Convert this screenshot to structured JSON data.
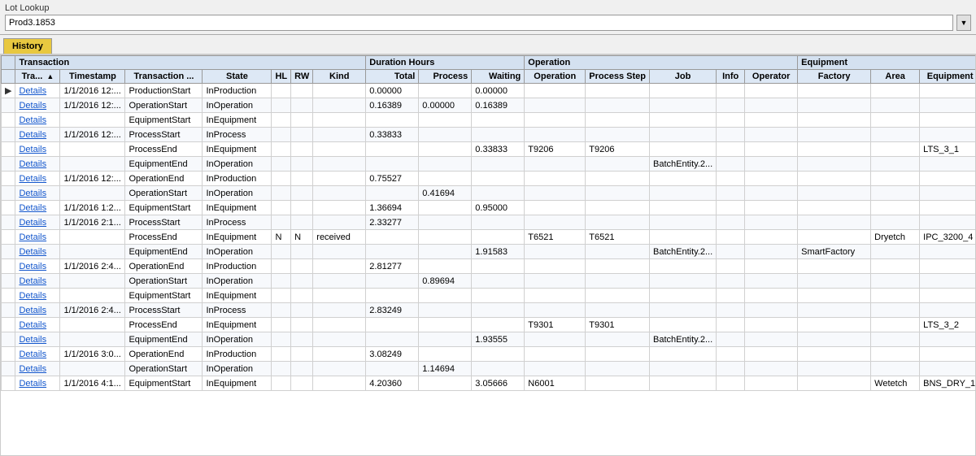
{
  "app": {
    "title": "Lot Lookup",
    "lot_value": "Prod3.1853"
  },
  "tab": {
    "label": "History"
  },
  "table": {
    "header_groups": [
      {
        "label": "Transaction",
        "colspan": 7
      },
      {
        "label": "Duration Hours",
        "colspan": 3
      },
      {
        "label": "Operation",
        "colspan": 5
      },
      {
        "label": "Equipment",
        "colspan": 3
      }
    ],
    "columns": [
      {
        "id": "arrow",
        "label": ""
      },
      {
        "id": "tra",
        "label": "Tra...",
        "sortable": true
      },
      {
        "id": "timestamp",
        "label": "Timestamp"
      },
      {
        "id": "transaction",
        "label": "Transaction ..."
      },
      {
        "id": "state",
        "label": "State"
      },
      {
        "id": "hl",
        "label": "HL"
      },
      {
        "id": "rw",
        "label": "RW"
      },
      {
        "id": "kind",
        "label": "Kind"
      },
      {
        "id": "total",
        "label": "Total"
      },
      {
        "id": "process",
        "label": "Process"
      },
      {
        "id": "waiting",
        "label": "Waiting"
      },
      {
        "id": "operation",
        "label": "Operation"
      },
      {
        "id": "processstep",
        "label": "Process Step"
      },
      {
        "id": "job",
        "label": "Job"
      },
      {
        "id": "info",
        "label": "Info"
      },
      {
        "id": "operator",
        "label": "Operator"
      },
      {
        "id": "factory",
        "label": "Factory"
      },
      {
        "id": "area",
        "label": "Area"
      },
      {
        "id": "equipment",
        "label": "Equipment"
      }
    ],
    "rows": [
      {
        "arrow": "▶",
        "tra": "Details",
        "timestamp": "1/1/2016 12:...",
        "transaction": "ProductionStart",
        "state": "InProduction",
        "hl": "",
        "rw": "",
        "kind": "",
        "total": "0.00000",
        "process": "",
        "waiting": "0.00000",
        "operation": "",
        "processstep": "",
        "job": "",
        "info": "",
        "operator": "",
        "factory": "",
        "area": "",
        "equipment": ""
      },
      {
        "arrow": "",
        "tra": "Details",
        "timestamp": "1/1/2016 12:...",
        "transaction": "OperationStart",
        "state": "InOperation",
        "hl": "",
        "rw": "",
        "kind": "",
        "total": "0.16389",
        "process": "0.00000",
        "waiting": "0.16389",
        "operation": "",
        "processstep": "",
        "job": "",
        "info": "",
        "operator": "",
        "factory": "",
        "area": "",
        "equipment": ""
      },
      {
        "arrow": "",
        "tra": "Details",
        "timestamp": "",
        "transaction": "EquipmentStart",
        "state": "InEquipment",
        "hl": "",
        "rw": "",
        "kind": "",
        "total": "",
        "process": "",
        "waiting": "",
        "operation": "",
        "processstep": "",
        "job": "",
        "info": "",
        "operator": "",
        "factory": "",
        "area": "",
        "equipment": ""
      },
      {
        "arrow": "",
        "tra": "Details",
        "timestamp": "1/1/2016 12:...",
        "transaction": "ProcessStart",
        "state": "InProcess",
        "hl": "",
        "rw": "",
        "kind": "",
        "total": "0.33833",
        "process": "",
        "waiting": "",
        "operation": "",
        "processstep": "",
        "job": "",
        "info": "",
        "operator": "",
        "factory": "",
        "area": "",
        "equipment": ""
      },
      {
        "arrow": "",
        "tra": "Details",
        "timestamp": "",
        "transaction": "ProcessEnd",
        "state": "InEquipment",
        "hl": "",
        "rw": "",
        "kind": "",
        "total": "",
        "process": "",
        "waiting": "0.33833",
        "operation": "T9206",
        "processstep": "T9206",
        "job": "",
        "info": "",
        "operator": "",
        "factory": "",
        "area": "",
        "equipment": "LTS_3_1"
      },
      {
        "arrow": "",
        "tra": "Details",
        "timestamp": "",
        "transaction": "EquipmentEnd",
        "state": "InOperation",
        "hl": "",
        "rw": "",
        "kind": "",
        "total": "",
        "process": "",
        "waiting": "",
        "operation": "",
        "processstep": "",
        "job": "BatchEntity.2...",
        "info": "",
        "operator": "",
        "factory": "",
        "area": "",
        "equipment": ""
      },
      {
        "arrow": "",
        "tra": "Details",
        "timestamp": "1/1/2016 12:...",
        "transaction": "OperationEnd",
        "state": "InProduction",
        "hl": "",
        "rw": "",
        "kind": "",
        "total": "0.75527",
        "process": "",
        "waiting": "",
        "operation": "",
        "processstep": "",
        "job": "",
        "info": "",
        "operator": "",
        "factory": "",
        "area": "",
        "equipment": ""
      },
      {
        "arrow": "",
        "tra": "Details",
        "timestamp": "",
        "transaction": "OperationStart",
        "state": "InOperation",
        "hl": "",
        "rw": "",
        "kind": "",
        "total": "",
        "process": "0.41694",
        "waiting": "",
        "operation": "",
        "processstep": "",
        "job": "",
        "info": "",
        "operator": "",
        "factory": "",
        "area": "",
        "equipment": ""
      },
      {
        "arrow": "",
        "tra": "Details",
        "timestamp": "1/1/2016 1:2...",
        "transaction": "EquipmentStart",
        "state": "InEquipment",
        "hl": "",
        "rw": "",
        "kind": "",
        "total": "1.36694",
        "process": "",
        "waiting": "0.95000",
        "operation": "",
        "processstep": "",
        "job": "",
        "info": "",
        "operator": "",
        "factory": "",
        "area": "",
        "equipment": ""
      },
      {
        "arrow": "",
        "tra": "Details",
        "timestamp": "1/1/2016 2:1...",
        "transaction": "ProcessStart",
        "state": "InProcess",
        "hl": "",
        "rw": "",
        "kind": "",
        "total": "2.33277",
        "process": "",
        "waiting": "",
        "operation": "",
        "processstep": "",
        "job": "",
        "info": "",
        "operator": "",
        "factory": "",
        "area": "",
        "equipment": ""
      },
      {
        "arrow": "",
        "tra": "Details",
        "timestamp": "",
        "transaction": "ProcessEnd",
        "state": "InEquipment",
        "hl": "N",
        "rw": "N",
        "kind": "received",
        "total": "",
        "process": "",
        "waiting": "",
        "operation": "T6521",
        "processstep": "T6521",
        "job": "",
        "info": "",
        "operator": "",
        "factory": "",
        "area": "Dryetch",
        "equipment": "IPC_3200_4"
      },
      {
        "arrow": "",
        "tra": "Details",
        "timestamp": "",
        "transaction": "EquipmentEnd",
        "state": "InOperation",
        "hl": "",
        "rw": "",
        "kind": "",
        "total": "",
        "process": "",
        "waiting": "1.91583",
        "operation": "",
        "processstep": "",
        "job": "BatchEntity.2...",
        "info": "",
        "operator": "",
        "factory": "SmartFactory",
        "area": "",
        "equipment": ""
      },
      {
        "arrow": "",
        "tra": "Details",
        "timestamp": "1/1/2016 2:4...",
        "transaction": "OperationEnd",
        "state": "InProduction",
        "hl": "",
        "rw": "",
        "kind": "",
        "total": "2.81277",
        "process": "",
        "waiting": "",
        "operation": "",
        "processstep": "",
        "job": "",
        "info": "",
        "operator": "",
        "factory": "",
        "area": "",
        "equipment": ""
      },
      {
        "arrow": "",
        "tra": "Details",
        "timestamp": "",
        "transaction": "OperationStart",
        "state": "InOperation",
        "hl": "",
        "rw": "",
        "kind": "",
        "total": "",
        "process": "0.89694",
        "waiting": "",
        "operation": "",
        "processstep": "",
        "job": "",
        "info": "",
        "operator": "",
        "factory": "",
        "area": "",
        "equipment": ""
      },
      {
        "arrow": "",
        "tra": "Details",
        "timestamp": "",
        "transaction": "EquipmentStart",
        "state": "InEquipment",
        "hl": "",
        "rw": "",
        "kind": "",
        "total": "",
        "process": "",
        "waiting": "",
        "operation": "",
        "processstep": "",
        "job": "",
        "info": "",
        "operator": "",
        "factory": "",
        "area": "",
        "equipment": ""
      },
      {
        "arrow": "",
        "tra": "Details",
        "timestamp": "1/1/2016 2:4...",
        "transaction": "ProcessStart",
        "state": "InProcess",
        "hl": "",
        "rw": "",
        "kind": "",
        "total": "2.83249",
        "process": "",
        "waiting": "",
        "operation": "",
        "processstep": "",
        "job": "",
        "info": "",
        "operator": "",
        "factory": "",
        "area": "",
        "equipment": ""
      },
      {
        "arrow": "",
        "tra": "Details",
        "timestamp": "",
        "transaction": "ProcessEnd",
        "state": "InEquipment",
        "hl": "",
        "rw": "",
        "kind": "",
        "total": "",
        "process": "",
        "waiting": "",
        "operation": "T9301",
        "processstep": "T9301",
        "job": "",
        "info": "",
        "operator": "",
        "factory": "",
        "area": "",
        "equipment": "LTS_3_2"
      },
      {
        "arrow": "",
        "tra": "Details",
        "timestamp": "",
        "transaction": "EquipmentEnd",
        "state": "InOperation",
        "hl": "",
        "rw": "",
        "kind": "",
        "total": "",
        "process": "",
        "waiting": "1.93555",
        "operation": "",
        "processstep": "",
        "job": "BatchEntity.2...",
        "info": "",
        "operator": "",
        "factory": "",
        "area": "",
        "equipment": ""
      },
      {
        "arrow": "",
        "tra": "Details",
        "timestamp": "1/1/2016 3:0...",
        "transaction": "OperationEnd",
        "state": "InProduction",
        "hl": "",
        "rw": "",
        "kind": "",
        "total": "3.08249",
        "process": "",
        "waiting": "",
        "operation": "",
        "processstep": "",
        "job": "",
        "info": "",
        "operator": "",
        "factory": "",
        "area": "",
        "equipment": ""
      },
      {
        "arrow": "",
        "tra": "Details",
        "timestamp": "",
        "transaction": "OperationStart",
        "state": "InOperation",
        "hl": "",
        "rw": "",
        "kind": "",
        "total": "",
        "process": "1.14694",
        "waiting": "",
        "operation": "",
        "processstep": "",
        "job": "",
        "info": "",
        "operator": "",
        "factory": "",
        "area": "",
        "equipment": ""
      },
      {
        "arrow": "",
        "tra": "Details",
        "timestamp": "1/1/2016 4:1...",
        "transaction": "EquipmentStart",
        "state": "InEquipment",
        "hl": "",
        "rw": "",
        "kind": "",
        "total": "4.20360",
        "process": "",
        "waiting": "3.05666",
        "operation": "N6001",
        "processstep": "",
        "job": "",
        "info": "",
        "operator": "",
        "factory": "",
        "area": "Wetetch",
        "equipment": "BNS_DRY_1"
      }
    ]
  }
}
